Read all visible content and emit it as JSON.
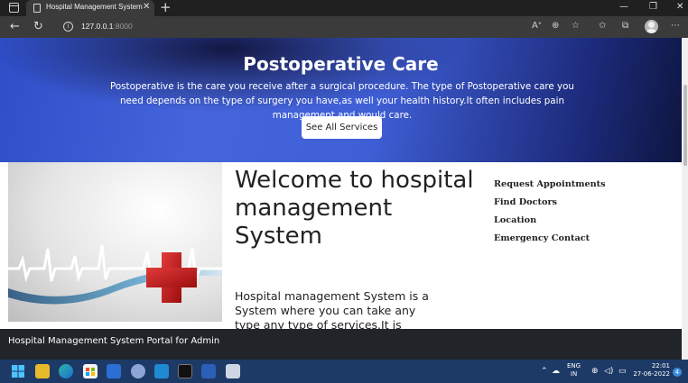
{
  "browser": {
    "tab_title": "Hospital Management System",
    "url_host": "127.0.0.1",
    "url_port": ":8000",
    "new_tab": "+",
    "close_tab": "✕"
  },
  "hero": {
    "title": "Postoperative Care",
    "text": "Postoperative is the care you receive after a surgical procedure. The type of Postoperative care you need depends on the type of surgery you have,as well your health history.It often includes pain management and would care.",
    "button_label": "See All Services"
  },
  "welcome": {
    "title": "Welcome to hospital management System",
    "description": "Hospital management System is a System where you can take any type any type of services.It is located in"
  },
  "links": [
    {
      "label": "Request Appointments"
    },
    {
      "label": "Find Doctors"
    },
    {
      "label": "Location"
    },
    {
      "label": "Emergency Contact"
    }
  ],
  "footer": {
    "text": "Hospital Management System Portal for Admin"
  },
  "taskbar": {
    "lang_line1": "ENG",
    "lang_line2": "IN",
    "time": "22:01",
    "date": "27-06-2022",
    "notification_count": "4"
  }
}
